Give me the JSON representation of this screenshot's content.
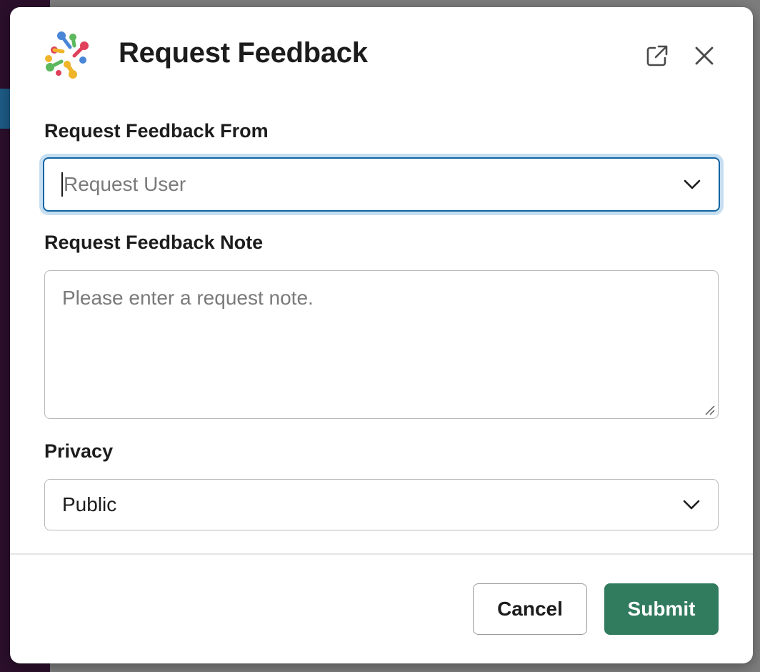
{
  "modal": {
    "title": "Request Feedback",
    "header_icons": {
      "open_in_new": "external-link-icon",
      "close": "close-icon"
    }
  },
  "form": {
    "request_from": {
      "label": "Request Feedback From",
      "placeholder": "Request User"
    },
    "note": {
      "label": "Request Feedback Note",
      "placeholder": "Please enter a request note."
    },
    "privacy": {
      "label": "Privacy",
      "value": "Public"
    }
  },
  "footer": {
    "cancel_label": "Cancel",
    "submit_label": "Submit"
  },
  "colors": {
    "submit": "#317b5e",
    "focus_border": "#1264a3",
    "focus_ring": "#c6def1"
  }
}
